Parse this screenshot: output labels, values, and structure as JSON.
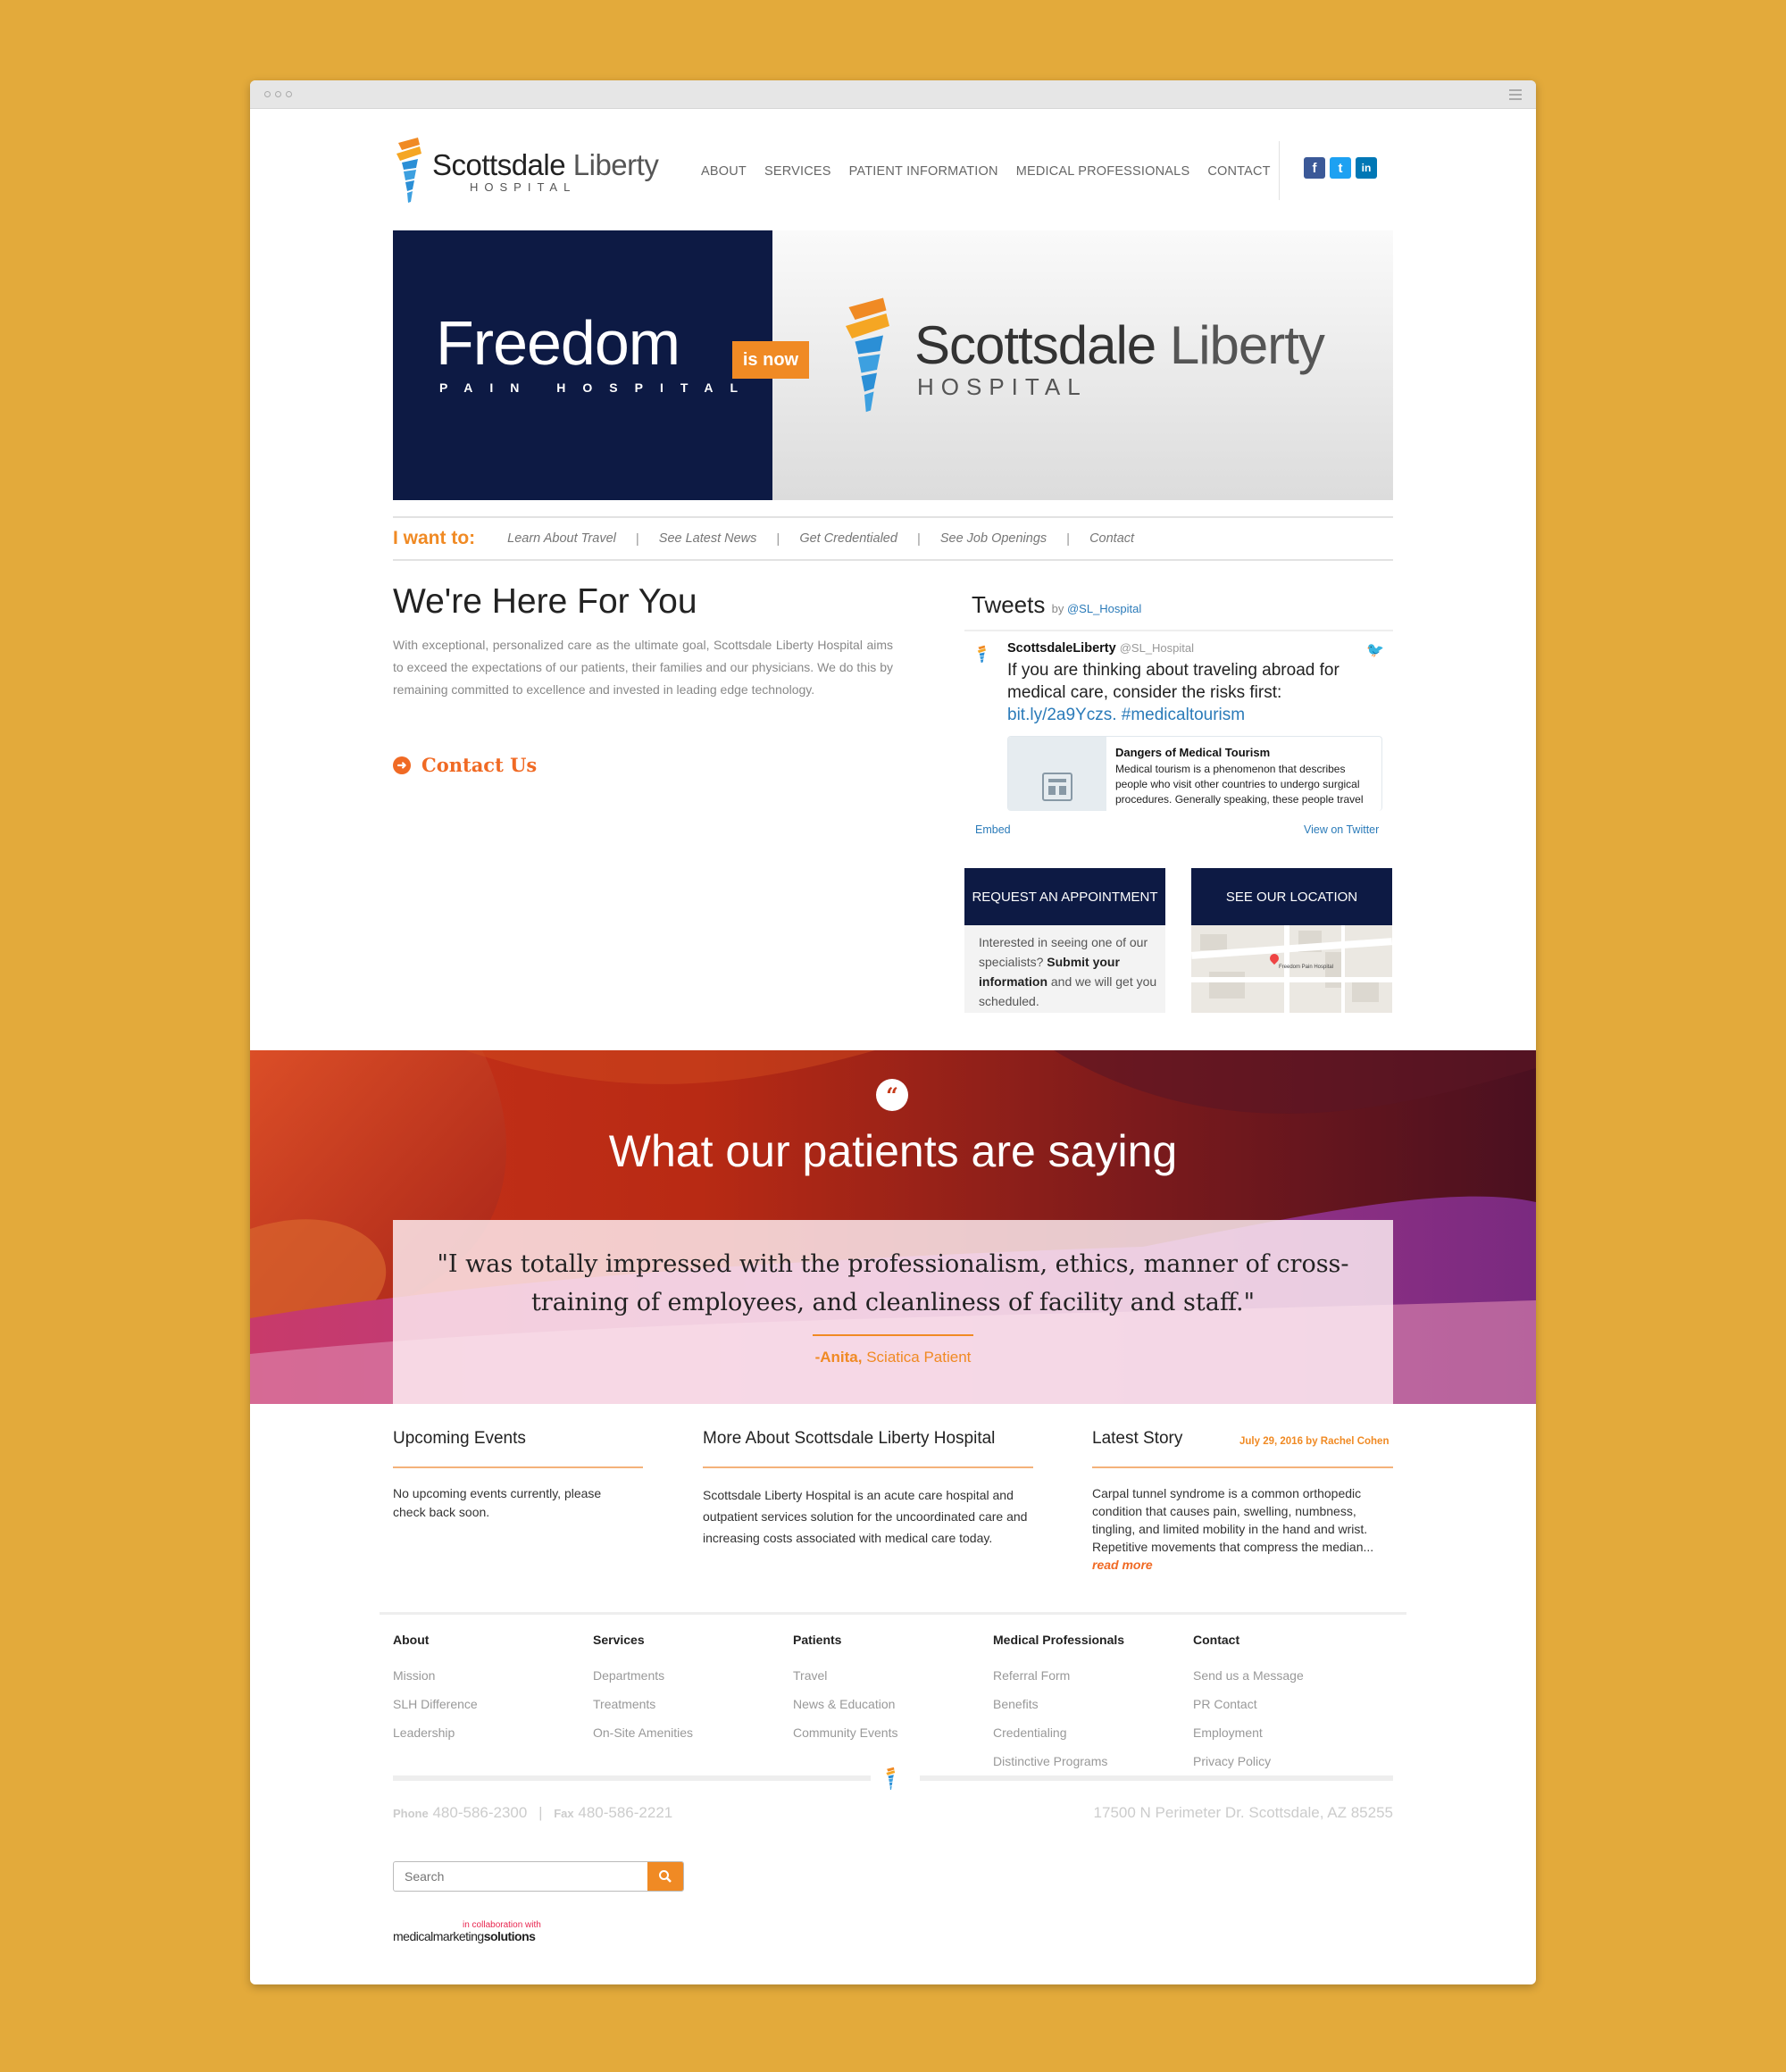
{
  "header": {
    "logo_name": "Scottsdale",
    "logo_name2": "Liberty",
    "logo_sub": "HOSPITAL",
    "nav": [
      "ABOUT",
      "SERVICES",
      "PATIENT INFORMATION",
      "MEDICAL PROFESSIONALS",
      "CONTACT"
    ],
    "social": [
      {
        "letter": "f",
        "icon": "facebook-icon",
        "color": "#3b5998"
      },
      {
        "letter": "t",
        "icon": "twitter-icon",
        "color": "#1da1f2"
      },
      {
        "letter": "in",
        "icon": "linkedin-icon",
        "color": "#0077b5"
      }
    ]
  },
  "banner": {
    "freedom": "Freedom",
    "pain": "PAIN HOSPITAL",
    "is_now": "is now",
    "logo_name": "Scottsdale",
    "logo_name2": "Liberty",
    "logo_sub": "HOSPITAL"
  },
  "iwant": {
    "label": "I want to:",
    "items": [
      "Learn About Travel",
      "See Latest News",
      "Get Credentialed",
      "See Job Openings",
      "Contact"
    ]
  },
  "main": {
    "title": "We're Here For You",
    "intro": "With exceptional, personalized care as the ultimate goal, Scottsdale Liberty Hospital aims to exceed the expectations of our patients, their families and our physicians. We do this by remaining committed to excellence and invested in leading edge technology.",
    "cta": "Contact Us"
  },
  "tweets": {
    "title": "Tweets",
    "by": "by",
    "handle": "@SL_Hospital",
    "user": "ScottsdaleLiberty",
    "user_handle": "@SL_Hospital",
    "text": "If you are thinking about traveling abroad for medical care, consider the risks first:",
    "link": "bit.ly/2a9Yczs. #medicaltourism",
    "card_title": "Dangers of Medical Tourism",
    "card_desc": "Medical tourism is a phenomenon that describes people who visit other countries to undergo surgical procedures. Generally speaking, these people travel",
    "embed": "Embed",
    "view": "View on Twitter"
  },
  "boxes": {
    "appointment_title": "REQUEST AN APPOINTMENT",
    "appointment_t1": "Interested in seeing one of our specialists?",
    "appointment_bold": "Submit your information",
    "appointment_t2": "and we will get you scheduled.",
    "location_title": "SEE OUR LOCATION",
    "map_label": "Freedom Pain Hospital"
  },
  "testimonial": {
    "heading": "What our patients are saying",
    "quote": "\"I was totally impressed with the professionalism, ethics, manner of cross-training of employees, and cleanliness of facility and staff.\"",
    "author": "-Anita,",
    "author_role": "Sciatica Patient"
  },
  "columns": {
    "events_title": "Upcoming Events",
    "events_text": "No upcoming events currently, please check back soon.",
    "about_title": "More About Scottsdale Liberty Hospital",
    "about_text": "Scottsdale Liberty Hospital is an acute care hospital and outpatient services solution for the uncoordinated care and increasing costs associated with medical care today.",
    "story_title": "Latest Story",
    "story_date": "July 29, 2016 by Rachel Cohen",
    "story_text": "Carpal tunnel syndrome is a common orthopedic condition that causes pain, swelling, numbness, tingling, and limited mobility in the hand and wrist. Repetitive movements that compress the median...",
    "read_more": "read more"
  },
  "footer": {
    "cols": [
      {
        "title": "About",
        "links": [
          "Mission",
          "SLH Difference",
          "Leadership"
        ]
      },
      {
        "title": "Services",
        "links": [
          "Departments",
          "Treatments",
          "On-Site Amenities"
        ]
      },
      {
        "title": "Patients",
        "links": [
          "Travel",
          "News & Education",
          "Community Events"
        ]
      },
      {
        "title": "Medical Professionals",
        "links": [
          "Referral Form",
          "Benefits",
          "Credentialing",
          "Distinctive Programs"
        ]
      },
      {
        "title": "Contact",
        "links": [
          "Send us a Message",
          "PR Contact",
          "Employment",
          "Privacy Policy"
        ]
      }
    ],
    "phone_label": "Phone",
    "phone": "480-586-2300",
    "sep": "|",
    "fax_label": "Fax",
    "fax": "480-586-2221",
    "address": "17500 N Perimeter Dr. Scottsdale, AZ 85255",
    "search_placeholder": "Search",
    "collab": "in collaboration with",
    "mms1": "medicalmarketing",
    "mms2": "solutions"
  }
}
